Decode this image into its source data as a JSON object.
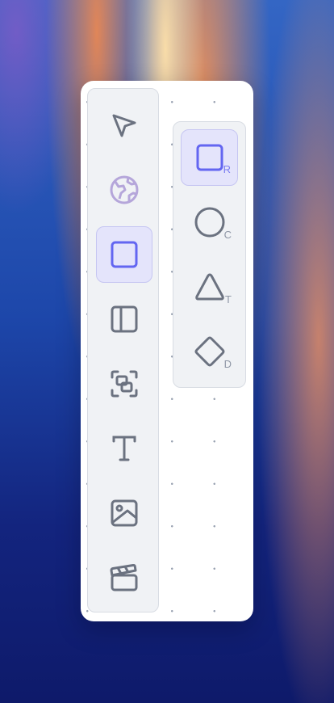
{
  "toolbar": {
    "tools": [
      {
        "name": "select",
        "icon": "pointer-arrow-icon",
        "active": false
      },
      {
        "name": "globe",
        "icon": "globe-icon",
        "active": false
      },
      {
        "name": "shapes",
        "icon": "square-icon",
        "active": true
      },
      {
        "name": "frame",
        "icon": "sidebar-panel-icon",
        "active": false
      },
      {
        "name": "group",
        "icon": "group-selection-icon",
        "active": false
      },
      {
        "name": "text",
        "icon": "text-t-icon",
        "active": false
      },
      {
        "name": "image",
        "icon": "image-icon",
        "active": false
      },
      {
        "name": "media",
        "icon": "clapperboard-icon",
        "active": false
      }
    ]
  },
  "shapes_menu": {
    "items": [
      {
        "icon": "square-icon",
        "shortcut": "R",
        "active": true
      },
      {
        "icon": "circle-icon",
        "shortcut": "C",
        "active": false
      },
      {
        "icon": "triangle-icon",
        "shortcut": "T",
        "active": false
      },
      {
        "icon": "diamond-icon",
        "shortcut": "D",
        "active": false
      }
    ]
  },
  "colors": {
    "accent": "#6366f1",
    "accent_bg": "#e4e4fb",
    "icon": "#6b7280",
    "globe": "#b5a6da"
  }
}
